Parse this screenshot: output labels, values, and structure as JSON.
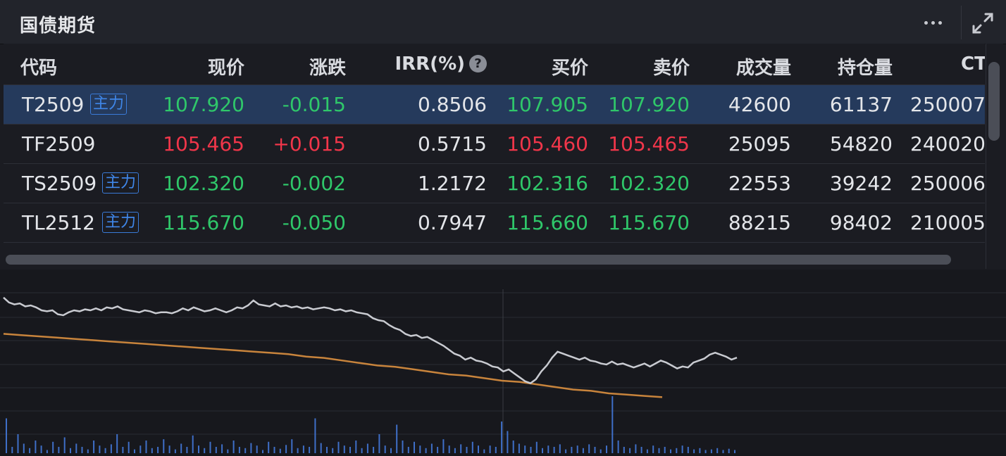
{
  "header": {
    "title": "国债期货"
  },
  "table": {
    "columns": [
      "代码",
      "现价",
      "涨跌",
      "IRR(%)",
      "买价",
      "卖价",
      "成交量",
      "持仓量",
      "CT"
    ],
    "rows": [
      {
        "code": "T2509",
        "tag": "主力",
        "price": "107.920",
        "change": "-0.015",
        "irr": "0.8506",
        "bid": "107.905",
        "ask": "107.920",
        "volume": "42600",
        "oi": "61137",
        "ct": "250007.",
        "tone": "green",
        "selected": true
      },
      {
        "code": "TF2509",
        "tag": "",
        "price": "105.465",
        "change": "+0.015",
        "irr": "0.5715",
        "bid": "105.460",
        "ask": "105.465",
        "volume": "25095",
        "oi": "54820",
        "ct": "240020.",
        "tone": "red",
        "selected": false
      },
      {
        "code": "TS2509",
        "tag": "主力",
        "price": "102.320",
        "change": "-0.002",
        "irr": "1.2172",
        "bid": "102.316",
        "ask": "102.320",
        "volume": "22553",
        "oi": "39242",
        "ct": "250006.",
        "tone": "green",
        "selected": false
      },
      {
        "code": "TL2512",
        "tag": "主力",
        "price": "115.670",
        "change": "-0.050",
        "irr": "0.7947",
        "bid": "115.660",
        "ask": "115.670",
        "volume": "88215",
        "oi": "98402",
        "ct": "210005.",
        "tone": "green",
        "selected": false
      }
    ]
  },
  "colors": {
    "up": "#f0364a",
    "down": "#2fc76a",
    "price_line": "#c9cbd1",
    "avg_line": "#c8843c",
    "volume_bar": "#3f6fc8",
    "selected_row": "#253a5c"
  },
  "icons": {
    "more": "more-dots-icon",
    "expand": "expand-arrows-icon",
    "help": "question-circle-icon"
  },
  "chart_data": {
    "type": "line",
    "price_series": [
      0.93,
      0.88,
      0.86,
      0.87,
      0.84,
      0.85,
      0.83,
      0.8,
      0.79,
      0.8,
      0.76,
      0.75,
      0.78,
      0.8,
      0.79,
      0.81,
      0.8,
      0.82,
      0.8,
      0.83,
      0.82,
      0.84,
      0.81,
      0.8,
      0.79,
      0.78,
      0.8,
      0.79,
      0.77,
      0.78,
      0.78,
      0.77,
      0.79,
      0.82,
      0.8,
      0.83,
      0.81,
      0.79,
      0.8,
      0.82,
      0.8,
      0.78,
      0.8,
      0.83,
      0.82,
      0.85,
      0.9,
      0.86,
      0.85,
      0.84,
      0.87,
      0.84,
      0.85,
      0.83,
      0.84,
      0.82,
      0.83,
      0.81,
      0.82,
      0.83,
      0.82,
      0.8,
      0.81,
      0.79,
      0.8,
      0.78,
      0.77,
      0.76,
      0.72,
      0.7,
      0.69,
      0.65,
      0.62,
      0.6,
      0.56,
      0.54,
      0.55,
      0.52,
      0.53,
      0.5,
      0.47,
      0.44,
      0.4,
      0.36,
      0.34,
      0.3,
      0.32,
      0.29,
      0.28,
      0.26,
      0.23,
      0.22,
      0.18,
      0.2,
      0.16,
      0.12,
      0.08,
      0.06,
      0.1,
      0.18,
      0.24,
      0.32,
      0.38,
      0.36,
      0.34,
      0.32,
      0.3,
      0.32,
      0.29,
      0.28,
      0.26,
      0.25,
      0.28,
      0.25,
      0.26,
      0.24,
      0.22,
      0.24,
      0.26,
      0.23,
      0.26,
      0.29,
      0.27,
      0.24,
      0.21,
      0.23,
      0.22,
      0.27,
      0.29,
      0.31,
      0.35,
      0.37,
      0.35,
      0.33,
      0.3,
      0.32
    ],
    "avg_series": [
      0.52,
      0.51,
      0.5,
      0.49,
      0.48,
      0.47,
      0.46,
      0.45,
      0.44,
      0.43,
      0.42,
      0.41,
      0.4,
      0.39,
      0.38,
      0.37,
      0.36,
      0.34,
      0.33,
      0.31,
      0.29,
      0.27,
      0.26,
      0.24,
      0.22,
      0.2,
      0.19,
      0.17,
      0.15,
      0.14,
      0.12,
      0.1,
      0.08,
      0.07,
      0.05,
      0.04,
      0.03,
      0.02
    ],
    "volume_series": [
      0.55,
      0.1,
      0.3,
      0.15,
      0.08,
      0.2,
      0.12,
      0.05,
      0.18,
      0.1,
      0.25,
      0.08,
      0.15,
      0.1,
      0.06,
      0.2,
      0.12,
      0.08,
      0.14,
      0.3,
      0.1,
      0.18,
      0.06,
      0.12,
      0.2,
      0.08,
      0.1,
      0.22,
      0.12,
      0.06,
      0.15,
      0.1,
      0.28,
      0.12,
      0.08,
      0.18,
      0.1,
      0.14,
      0.06,
      0.2,
      0.1,
      0.08,
      0.16,
      0.12,
      0.05,
      0.18,
      0.1,
      0.07,
      0.13,
      0.22,
      0.08,
      0.12,
      0.1,
      0.55,
      0.16,
      0.1,
      0.08,
      0.18,
      0.12,
      0.1,
      0.2,
      0.08,
      0.15,
      0.1,
      0.3,
      0.12,
      0.08,
      0.45,
      0.2,
      0.1,
      0.18,
      0.12,
      0.08,
      0.15,
      0.1,
      0.22,
      0.12,
      0.08,
      0.14,
      0.1,
      0.18,
      0.12,
      0.06,
      0.12,
      0.1,
      0.5,
      0.35,
      0.2,
      0.15,
      0.12,
      0.1,
      0.18,
      0.08,
      0.12,
      0.1,
      0.14,
      0.06,
      0.1,
      0.12,
      0.08,
      0.14,
      0.1,
      0.06,
      0.12,
      0.9,
      0.2,
      0.1,
      0.08,
      0.14,
      0.1,
      0.06,
      0.12,
      0.08,
      0.1,
      0.06,
      0.08,
      0.12,
      0.1,
      0.06,
      0.08,
      0.05,
      0.06,
      0.08,
      0.05,
      0.07,
      0.05
    ]
  }
}
